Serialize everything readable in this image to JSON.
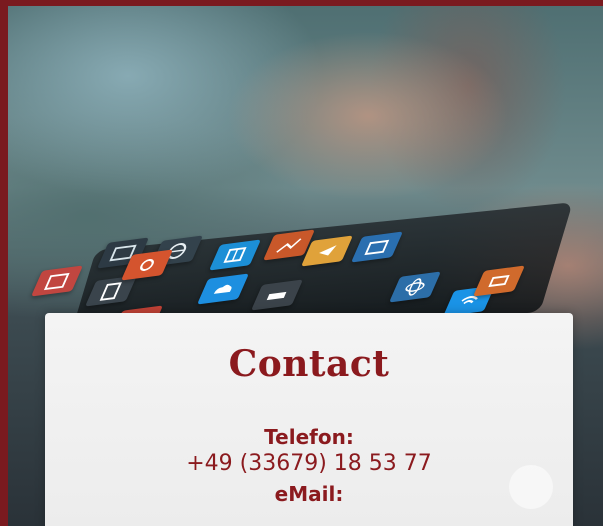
{
  "contact": {
    "title": "Contact",
    "phone_label": "Telefon:",
    "phone_value": "+49 (33679) 18 53 77",
    "email_label": "eMail:"
  },
  "colors": {
    "frame": "#7a1a1f",
    "accent": "#8b1a1e",
    "card": "#f2f2f2"
  },
  "icons": [
    "book-icon",
    "globe-icon",
    "grid-icon",
    "chart-icon",
    "plane-icon",
    "mail-icon",
    "atom-icon",
    "wifi-icon",
    "calendar-icon",
    "document-icon",
    "gear-icon",
    "cloud-icon",
    "car-icon",
    "tag-icon"
  ]
}
